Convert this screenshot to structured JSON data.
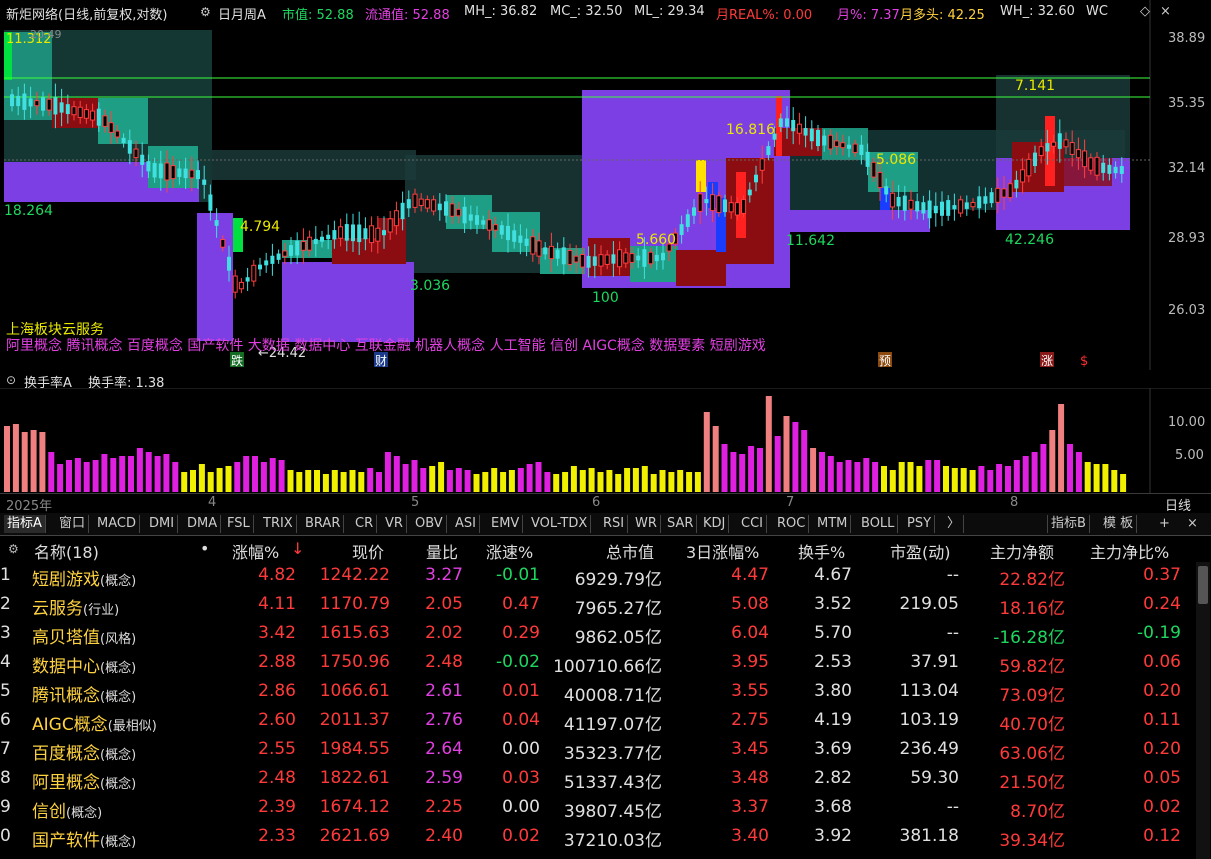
{
  "header": {
    "title": "新炬网络(日线,前复权,对数)",
    "period_label": "日月周A",
    "market_cap": "市值: 52.88",
    "float_cap": "流通值: 52.88",
    "mh": "MH_: 36.82",
    "mc": "MC_: 32.50",
    "ml": "ML_: 29.34",
    "month_real": "月REAL%: 0.00",
    "month_pct": "月%: 7.37",
    "month_bull": "月多头: 42.25",
    "wh": "WH_: 32.60",
    "wc_cut": "WC"
  },
  "price_axis": [
    "38.89",
    "35.35",
    "32.14",
    "28.93",
    "26.03"
  ],
  "chart_labels": {
    "top_left_1": "11.312",
    "top_left_2": "20.49",
    "lbl_18264": "18.264",
    "lbl_4794": "4.794",
    "lbl_3036": "3.036",
    "lbl_2442": "←24.42",
    "lbl_5660": "5.660",
    "lbl_100": "100",
    "lbl_16816": "16.816",
    "lbl_11642": "11.642",
    "lbl_5086": "5.086",
    "lbl_7141": "7.141",
    "lbl_42246": "42.246"
  },
  "board": {
    "industry": "上海板块云服务",
    "concepts": "阿里概念  腾讯概念  百度概念  国产软件  大数据  数据中心  互联金融  机器人概念  人工智能  信创  AIGC概念  数据要素  短剧游戏"
  },
  "markers": {
    "m1": "跌",
    "m2": "财",
    "m3": "预",
    "m4": "涨",
    "m5": "$"
  },
  "volume_header": {
    "name": "换手率A",
    "value": "换手率: 1.38"
  },
  "volume_axis": [
    "10.00",
    "5.00"
  ],
  "time_axis": {
    "year": "2025年",
    "m4": "4",
    "m5": "5",
    "m6": "6",
    "m7": "7",
    "m8": "8",
    "period_btn": "日线"
  },
  "indicator_tabs": [
    "指标A",
    "窗口",
    "MACD",
    "DMI",
    "DMA",
    "FSL",
    "TRIX",
    "BRAR",
    "CR",
    "VR",
    "OBV",
    "ASI",
    "EMV",
    "VOL-TDX",
    "RSI",
    "WR",
    "SAR",
    "KDJ",
    "CCI",
    "ROC",
    "MTM",
    "BOLL",
    "PSY",
    "〉"
  ],
  "tabs_right": {
    "indicator_b": "指标B",
    "template": "模 板",
    "plus": "+",
    "close": "×"
  },
  "table": {
    "name_header": "名称(18)",
    "columns": [
      "涨幅%",
      "现价",
      "量比",
      "涨速%",
      "总市值",
      "3日涨幅%",
      "换手%",
      "市盈(动)",
      "主力净额",
      "主力净比%"
    ],
    "sort_arrow": "↓",
    "rows": [
      {
        "idx": "1",
        "name": "短剧游戏",
        "type": "(概念)",
        "chg": "4.82",
        "price": "1242.22",
        "vr": "3.27",
        "spd": "-0.01",
        "cap": "6929.79亿",
        "chg3": "4.47",
        "turn": "4.67",
        "pe": "--",
        "net": "22.82亿",
        "netp": "0.37"
      },
      {
        "idx": "2",
        "name": "云服务",
        "type": "(行业)",
        "chg": "4.11",
        "price": "1170.79",
        "vr": "2.05",
        "spd": "0.47",
        "cap": "7965.27亿",
        "chg3": "5.08",
        "turn": "3.52",
        "pe": "219.05",
        "net": "18.16亿",
        "netp": "0.24"
      },
      {
        "idx": "3",
        "name": "高贝塔值",
        "type": "(风格)",
        "chg": "3.42",
        "price": "1615.63",
        "vr": "2.02",
        "spd": "0.29",
        "cap": "9862.05亿",
        "chg3": "6.04",
        "turn": "5.70",
        "pe": "--",
        "net": "-16.28亿",
        "netp": "-0.19"
      },
      {
        "idx": "4",
        "name": "数据中心",
        "type": "(概念)",
        "chg": "2.88",
        "price": "1750.96",
        "vr": "2.48",
        "spd": "-0.02",
        "cap": "100710.66亿",
        "chg3": "3.95",
        "turn": "2.53",
        "pe": "37.91",
        "net": "59.82亿",
        "netp": "0.06"
      },
      {
        "idx": "5",
        "name": "腾讯概念",
        "type": "(概念)",
        "chg": "2.86",
        "price": "1066.61",
        "vr": "2.61",
        "spd": "0.01",
        "cap": "40008.71亿",
        "chg3": "3.55",
        "turn": "3.80",
        "pe": "113.04",
        "net": "73.09亿",
        "netp": "0.20"
      },
      {
        "idx": "6",
        "name": "AIGC概念",
        "type": "(最相似)",
        "chg": "2.60",
        "price": "2011.37",
        "vr": "2.76",
        "spd": "0.04",
        "cap": "41197.07亿",
        "chg3": "2.75",
        "turn": "4.19",
        "pe": "103.19",
        "net": "40.70亿",
        "netp": "0.11"
      },
      {
        "idx": "7",
        "name": "百度概念",
        "type": "(概念)",
        "chg": "2.55",
        "price": "1984.55",
        "vr": "2.64",
        "spd": "0.00",
        "cap": "35323.77亿",
        "chg3": "3.45",
        "turn": "3.69",
        "pe": "236.49",
        "net": "63.06亿",
        "netp": "0.20"
      },
      {
        "idx": "8",
        "name": "阿里概念",
        "type": "(概念)",
        "chg": "2.48",
        "price": "1822.61",
        "vr": "2.59",
        "spd": "0.03",
        "cap": "51337.43亿",
        "chg3": "3.48",
        "turn": "2.82",
        "pe": "59.30",
        "net": "21.50亿",
        "netp": "0.05"
      },
      {
        "idx": "9",
        "name": "信创",
        "type": "(概念)",
        "chg": "2.39",
        "price": "1674.12",
        "vr": "2.25",
        "spd": "0.00",
        "cap": "39807.45亿",
        "chg3": "3.37",
        "turn": "3.68",
        "pe": "--",
        "net": "8.70亿",
        "netp": "0.02"
      },
      {
        "idx": "0",
        "name": "国产软件",
        "type": "(概念)",
        "chg": "2.33",
        "price": "2621.69",
        "vr": "2.40",
        "spd": "0.02",
        "cap": "37210.03亿",
        "chg3": "3.40",
        "turn": "3.92",
        "pe": "381.18",
        "net": "39.34亿",
        "netp": "0.12"
      }
    ]
  },
  "colors": {
    "up": "#ff3a3a",
    "down": "#1ed760",
    "magenta": "#e040e0",
    "violet": "#7b3fe4",
    "teal": "#1f9e86",
    "yellow": "#ffd23f"
  }
}
